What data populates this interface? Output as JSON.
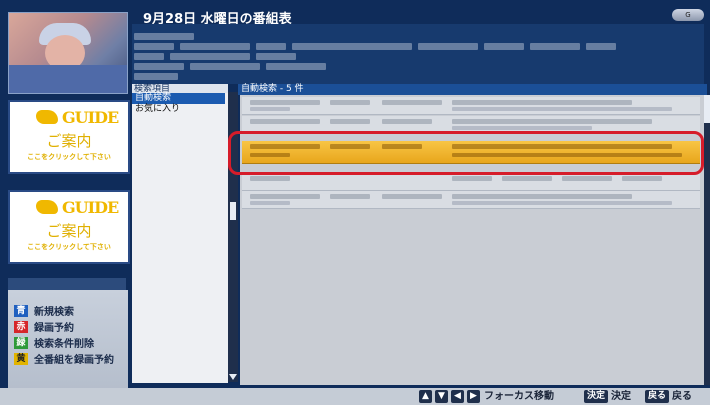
{
  "header": {
    "title": "9月28日 水曜日の番組表",
    "logo": "G"
  },
  "search_panel": {
    "header": "検索項目",
    "items": [
      {
        "label": "自動検索",
        "selected": true
      },
      {
        "label": "お気に入り",
        "selected": false
      }
    ]
  },
  "results": {
    "header": "自動検索 - 5 件",
    "count": 5,
    "highlighted_index": 2
  },
  "ads": [
    {
      "logo_text": "GUIDE",
      "main": "ご案内",
      "sub": "ここをクリックして下さい"
    },
    {
      "logo_text": "GUIDE",
      "main": "ご案内",
      "sub": "ここをクリックして下さい"
    }
  ],
  "legend": [
    {
      "key": "青",
      "label": "新規検索",
      "color": "#1f5fbf"
    },
    {
      "key": "赤",
      "label": "録画予約",
      "color": "#d6262a"
    },
    {
      "key": "緑",
      "label": "検索条件削除",
      "color": "#2e9a3a"
    },
    {
      "key": "黄",
      "label": "全番組を録画予約",
      "color": "#e2b400"
    }
  ],
  "footer": {
    "focus_label": "フォーカス移動",
    "decide_key": "決定",
    "decide_label": "決定",
    "back_key": "戻る",
    "back_label": "戻る"
  },
  "colors": {
    "background": "#0f2c5a",
    "selected": "#1b5bb0",
    "highlight": "#f2b52f",
    "focus_ring": "#d61c2a"
  }
}
